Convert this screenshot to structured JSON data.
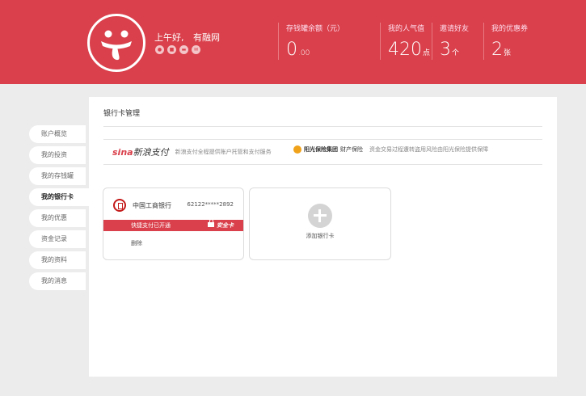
{
  "header": {
    "greeting": "上午好,",
    "username": "有融网",
    "mini_icons": [
      "user-icon",
      "id-icon",
      "card-icon",
      "mail-icon"
    ],
    "stats": [
      {
        "label": "存钱罐余额（元）",
        "value": "0",
        "unit": ".00"
      },
      {
        "label": "我的人气值",
        "value": "420",
        "unit": "点"
      },
      {
        "label": "邀请好友",
        "value": "3",
        "unit": "个"
      },
      {
        "label": "我的优惠券",
        "value": "2",
        "unit": "张"
      }
    ]
  },
  "sidebar": {
    "items": [
      {
        "label": "账户概览"
      },
      {
        "label": "我的投资"
      },
      {
        "label": "我的存钱罐"
      },
      {
        "label": "我的银行卡"
      },
      {
        "label": "我的优惠"
      },
      {
        "label": "资金记录"
      },
      {
        "label": "我的资料"
      },
      {
        "label": "我的消息"
      }
    ],
    "active_index": 3
  },
  "panel": {
    "title": "银行卡管理",
    "partners": [
      {
        "logo_main": "sina",
        "logo_sub": "新浪支付",
        "desc": "新浪支付全程提供账户托管和支付服务"
      },
      {
        "logo_main": "阳光保险集团",
        "logo_sub": "财产保险",
        "desc": "资金交易过程遭转盗用风险由阳光保险提供保障"
      }
    ],
    "bank_card": {
      "bank_name": "中国工商银行",
      "card_number": "62122*****2892",
      "status": "快捷支付已开通",
      "badge": "安全卡",
      "delete_label": "删除"
    },
    "add_card": {
      "label": "添加银行卡"
    }
  },
  "colors": {
    "brand": "#d9404b",
    "background": "#ececec"
  }
}
